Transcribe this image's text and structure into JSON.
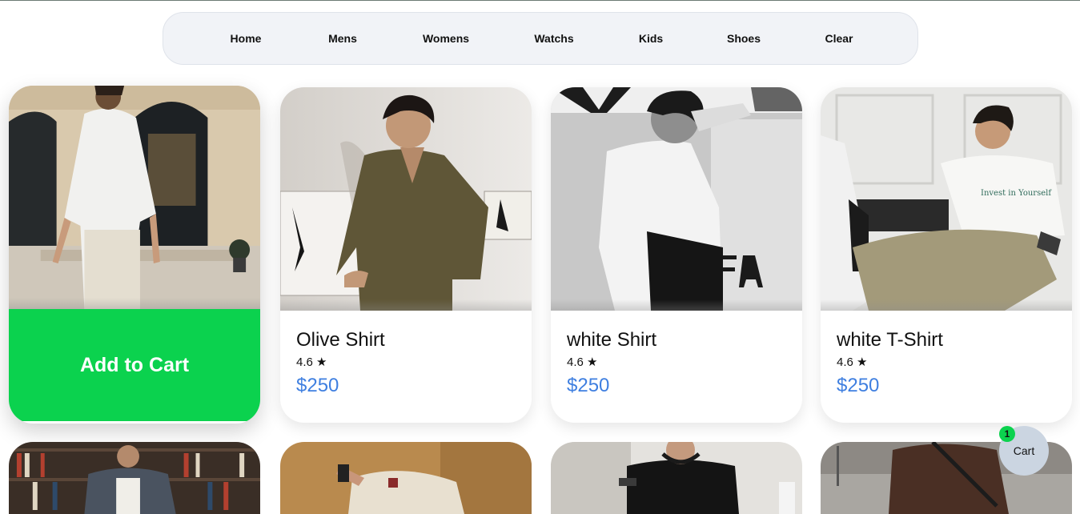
{
  "nav": {
    "items": [
      {
        "label": "Home"
      },
      {
        "label": "Mens"
      },
      {
        "label": "Womens"
      },
      {
        "label": "Watchs"
      },
      {
        "label": "Kids"
      },
      {
        "label": "Shoes"
      },
      {
        "label": "Clear"
      }
    ]
  },
  "products": [
    {
      "title": "",
      "rating": "",
      "price": "",
      "button_label": "Add to Cart"
    },
    {
      "title": "Olive Shirt",
      "rating": "4.6 ★",
      "price": "$250"
    },
    {
      "title": "white Shirt",
      "rating": "4.6 ★",
      "price": "$250"
    },
    {
      "title": "white T-Shirt",
      "rating": "4.6 ★",
      "price": "$250"
    }
  ],
  "cart": {
    "label": "Cart",
    "count": "1"
  },
  "colors": {
    "accent_green": "#0bd24e",
    "price_blue": "#3f7fe0",
    "nav_bg": "#f1f3f7",
    "cart_bg": "#cbd5e1"
  }
}
